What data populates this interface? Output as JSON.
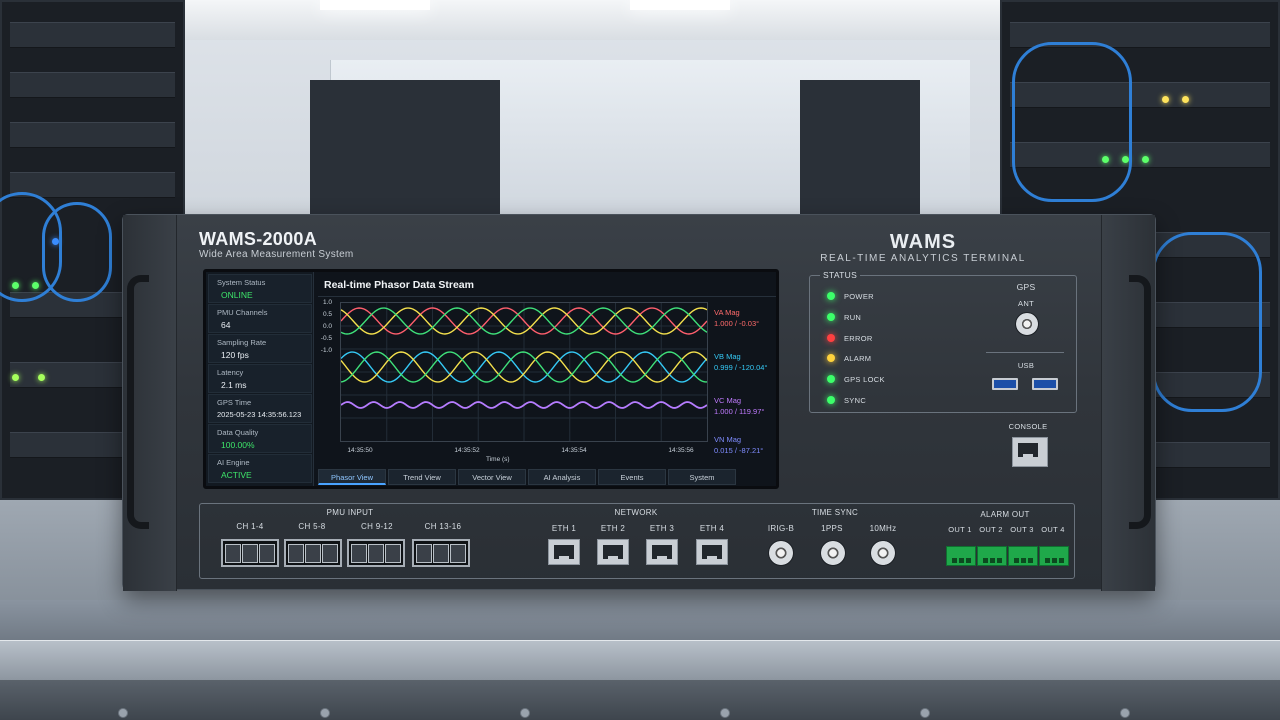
{
  "device": {
    "model": "WAMS-2000A",
    "model_subtitle": "Wide Area Measurement System",
    "brand": "WAMS",
    "brand_subtitle": "REAL-TIME ANALYTICS TERMINAL"
  },
  "screen": {
    "sidebar": [
      {
        "label": "System Status",
        "value": "ONLINE",
        "status": "ok"
      },
      {
        "label": "PMU Channels",
        "value": "64",
        "status": "normal"
      },
      {
        "label": "Sampling Rate",
        "value": "120 fps",
        "status": "normal"
      },
      {
        "label": "Latency",
        "value": "2.1 ms",
        "status": "normal"
      },
      {
        "label": "GPS Time",
        "value": "2025-05-23 14:35:56.123",
        "status": "normal"
      },
      {
        "label": "Data Quality",
        "value": "100.00%",
        "status": "ok"
      },
      {
        "label": "AI Engine",
        "value": "ACTIVE",
        "status": "ok"
      }
    ],
    "plot_title": "Real-time Phasor Data Stream",
    "tabs": [
      {
        "label": "Phasor View",
        "active": true
      },
      {
        "label": "Trend View",
        "active": false
      },
      {
        "label": "Vector View",
        "active": false
      },
      {
        "label": "AI Analysis",
        "active": false
      },
      {
        "label": "Events",
        "active": false
      },
      {
        "label": "System",
        "active": false
      }
    ]
  },
  "chart_data": {
    "type": "line",
    "title": "Real-time Phasor Data Stream",
    "xlabel": "Time (s)",
    "ylabel": "",
    "x_ticks": [
      "14:35:50",
      "14:35:52",
      "14:35:54",
      "14:35:56"
    ],
    "y_ticks": [
      "1.0",
      "0.5",
      "0.0",
      "-0.5",
      "-1.0"
    ],
    "grid": true,
    "legend_position": "right",
    "series": [
      {
        "name": "VA Mag",
        "value_text": "1.000 / -0.03°",
        "color": "#ff6b6b"
      },
      {
        "name": "VB Mag",
        "value_text": "0.999 / -120.04°",
        "color": "#35c9f5"
      },
      {
        "name": "VC Mag",
        "value_text": "1.000 / 119.97°",
        "color": "#c07bff"
      },
      {
        "name": "VN Mag",
        "value_text": "0.015 / -87.21°",
        "color": "#7f8cff"
      }
    ],
    "trace_colors": [
      "#ff5f6d",
      "#f4e04d",
      "#3fe07a",
      "#35c9f5",
      "#b67cff"
    ]
  },
  "status_panel": {
    "title": "STATUS",
    "leds": [
      {
        "label": "POWER",
        "color": "#3cff6a"
      },
      {
        "label": "RUN",
        "color": "#3cff6a"
      },
      {
        "label": "ERROR",
        "color": "#ff4040"
      },
      {
        "label": "ALARM",
        "color": "#ffd23c"
      },
      {
        "label": "GPS LOCK",
        "color": "#3cff6a"
      },
      {
        "label": "SYNC",
        "color": "#3cff6a"
      }
    ],
    "gps_label": "GPS",
    "ant_label": "ANT",
    "usb_label": "USB",
    "console_label": "CONSOLE"
  },
  "io": {
    "pmu_title": "PMU INPUT",
    "pmu_channels": [
      "CH 1-4",
      "CH 5-8",
      "CH 9-12",
      "CH 13-16"
    ],
    "network_title": "NETWORK",
    "network_ports": [
      "ETH 1",
      "ETH 2",
      "ETH 3",
      "ETH 4"
    ],
    "timesync_title": "TIME SYNC",
    "timesync_ports": [
      "IRIG-B",
      "1PPS",
      "10MHz"
    ],
    "alarm_title": "ALARM OUT",
    "alarm_ports": [
      "OUT 1",
      "OUT 2",
      "OUT 3",
      "OUT 4"
    ]
  }
}
